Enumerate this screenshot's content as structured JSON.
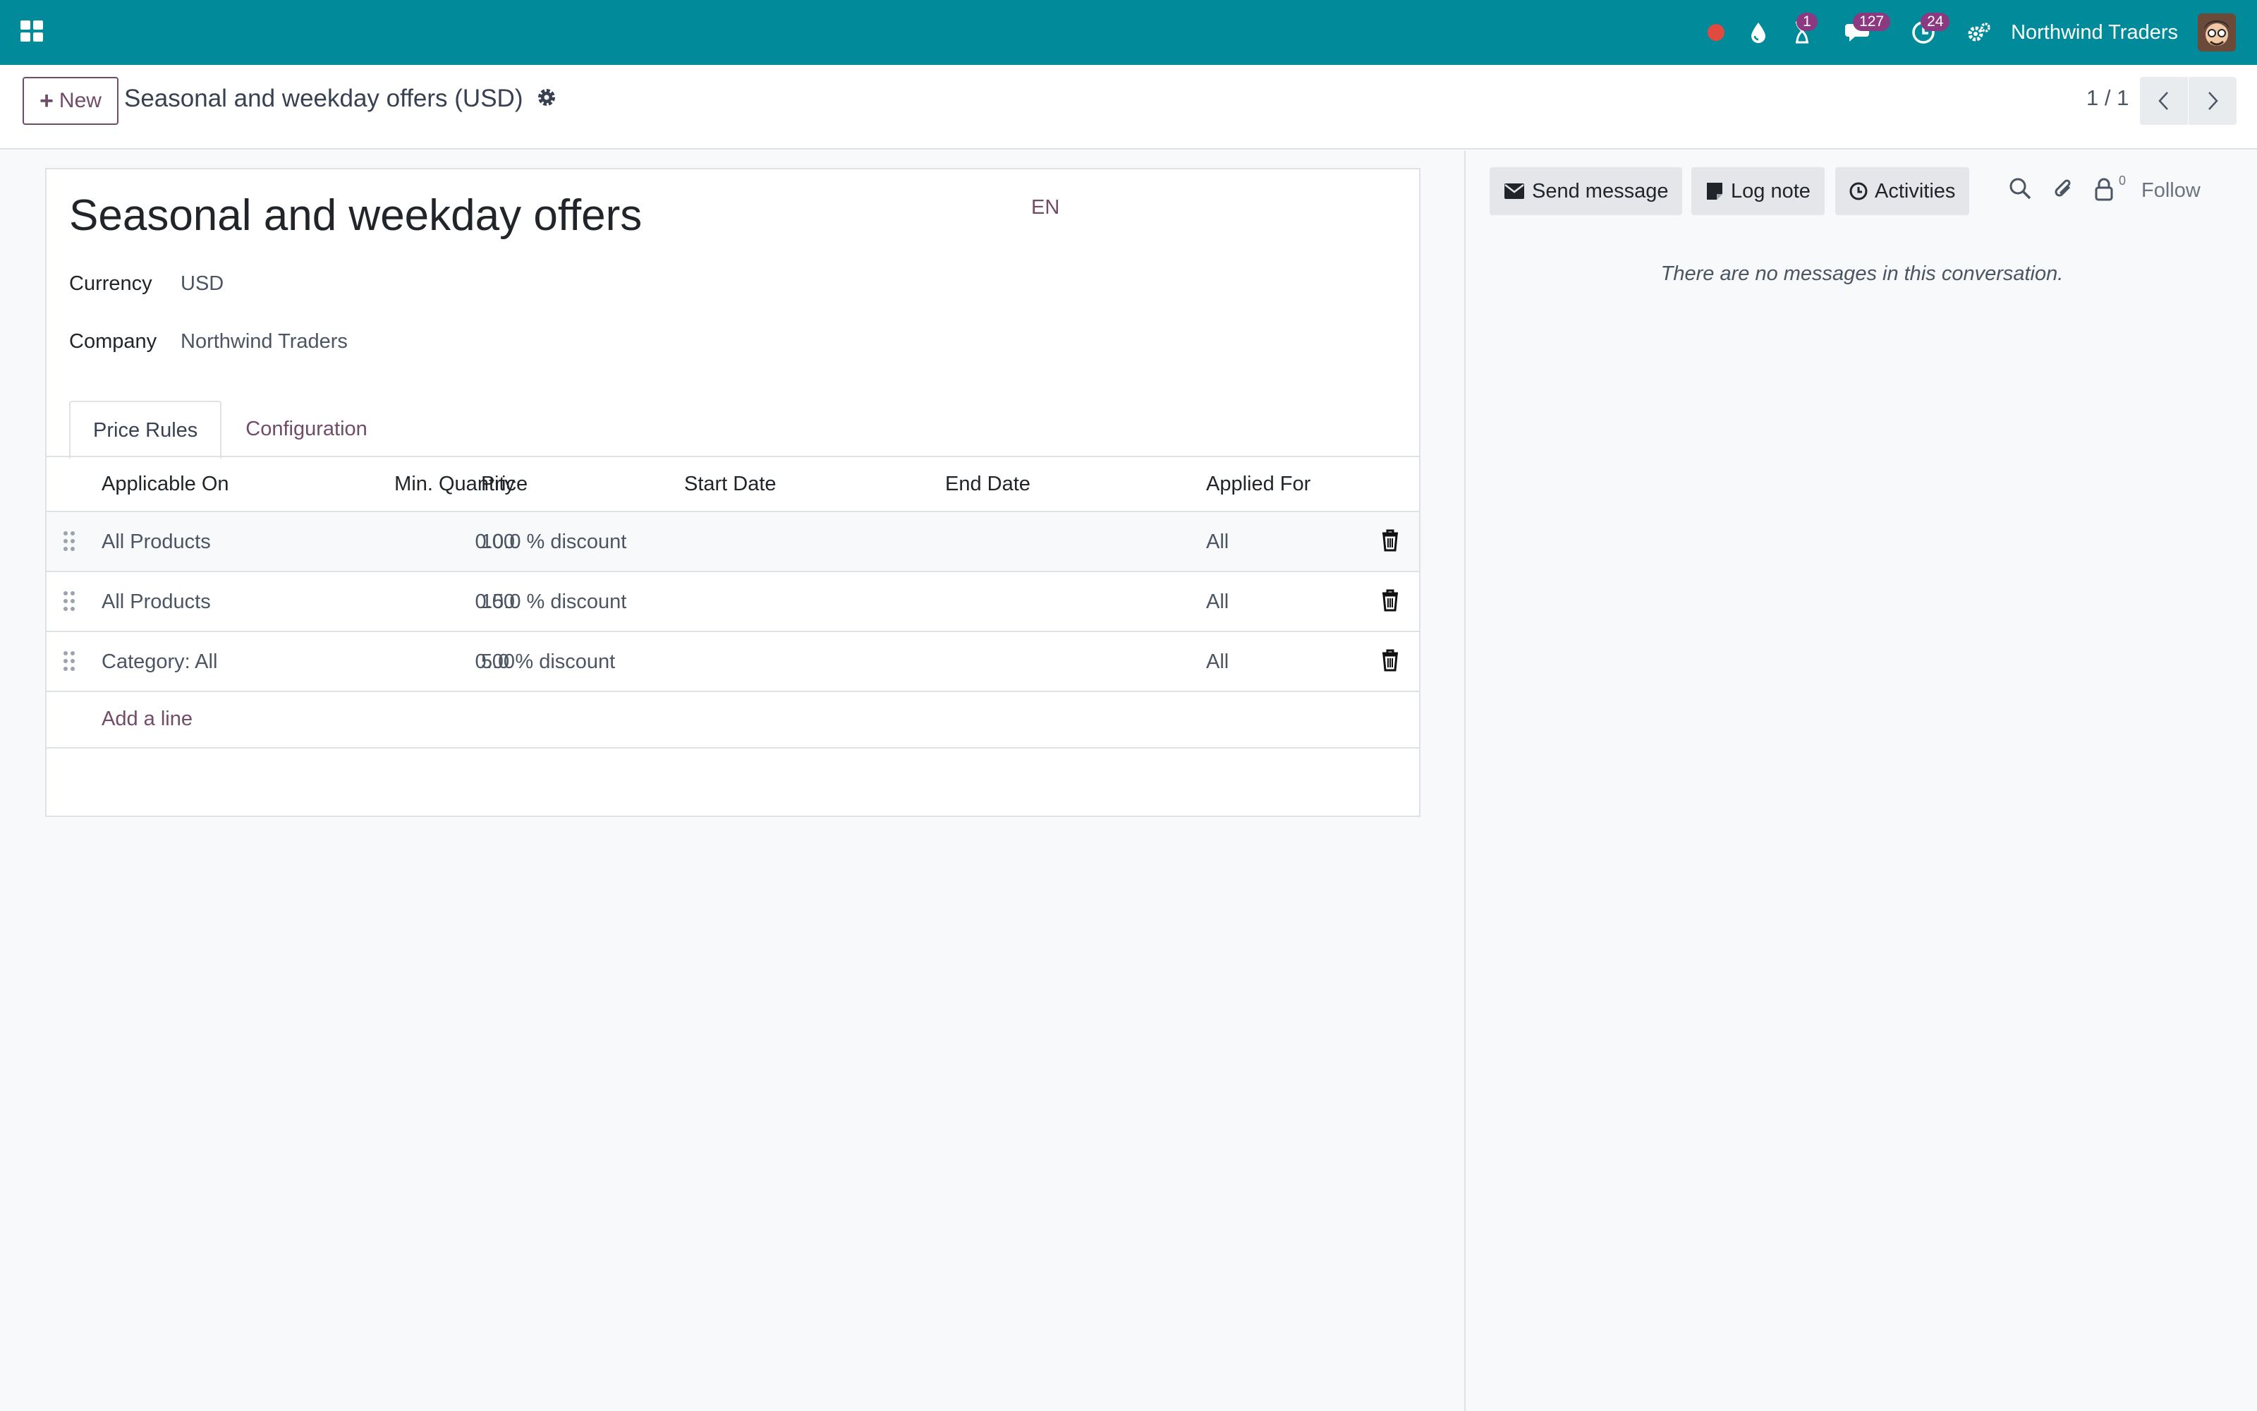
{
  "navbar": {
    "company": "Northwind Traders",
    "activity_count": "1",
    "messages_count": "127",
    "activities_count": "24",
    "accent": "#018a9a",
    "badge_color": "#8b3a82",
    "icons": [
      "apps-icon",
      "record-icon",
      "drop-icon",
      "hourglass-icon",
      "chat-icon",
      "clock-icon",
      "settings-icon"
    ]
  },
  "control_panel": {
    "new_label": "New",
    "record_title": "Seasonal and weekday offers (USD)",
    "pager": "1 / 1"
  },
  "form": {
    "name": "Seasonal and weekday offers",
    "lang": "EN",
    "fields": {
      "currency_label": "Currency",
      "currency_value": "USD",
      "company_label": "Company",
      "company_value": "Northwind Traders"
    },
    "tabs": [
      {
        "label": "Price Rules",
        "active": true
      },
      {
        "label": "Configuration",
        "active": false
      }
    ],
    "table": {
      "headers": [
        "Applicable On",
        "Min. Quantity",
        "Price",
        "Start Date",
        "End Date",
        "Applied For"
      ],
      "rows": [
        {
          "applicable_on": "All Products",
          "min_qty": "0.00",
          "price": "10.0 % discount",
          "start_date": "",
          "end_date": "",
          "applied_for": "All"
        },
        {
          "applicable_on": "All Products",
          "min_qty": "0.00",
          "price": "15.0 % discount",
          "start_date": "",
          "end_date": "",
          "applied_for": "All"
        },
        {
          "applicable_on": "Category: All",
          "min_qty": "0.00",
          "price": "5.0 % discount",
          "start_date": "",
          "end_date": "",
          "applied_for": "All"
        }
      ],
      "add_line": "Add a line"
    }
  },
  "chatter": {
    "send_message": "Send message",
    "log_note": "Log note",
    "activities": "Activities",
    "followers_count": "0",
    "follow": "Follow",
    "empty": "There are no messages in this conversation."
  },
  "colors": {
    "primary": "#714b67",
    "navbar": "#018a9a",
    "record_dot": "#e04a3f"
  }
}
